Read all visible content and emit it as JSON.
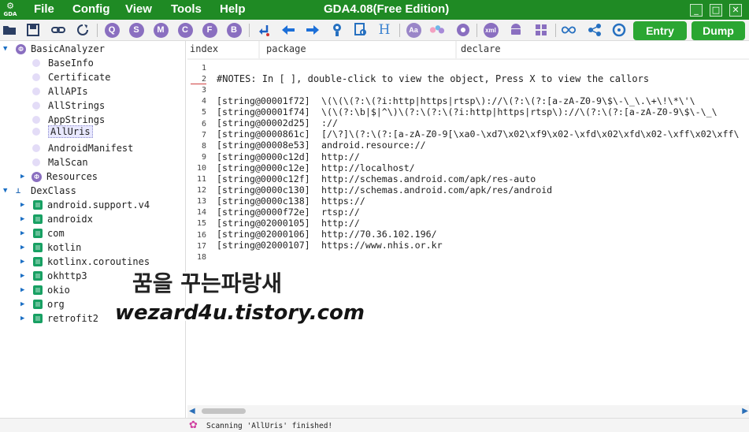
{
  "app": {
    "logo_text": "GDA",
    "title": "GDA4.08(Free Edition)",
    "menu": [
      "File",
      "Config",
      "View",
      "Tools",
      "Help"
    ]
  },
  "toolbar": {
    "circle_letters": [
      "Q",
      "S",
      "M",
      "C",
      "F",
      "B"
    ],
    "xml_label": "xml",
    "aa_label": "Aa",
    "h_label": "H",
    "entry_label": "Entry",
    "dump_label": "Dump"
  },
  "tree": {
    "root_label": "BasicAnalyzer",
    "basic_items": [
      "BaseInfo",
      "Certificate",
      "AllAPIs",
      "AllStrings",
      "AppStrings",
      "AllUris",
      "AndroidManifest",
      "MalScan"
    ],
    "selected": "AllUris",
    "resources_label": "Resources",
    "dex_label": "DexClass",
    "packages": [
      "android.support.v4",
      "androidx",
      "com",
      "kotlin",
      "kotlinx.coroutines",
      "okhttp3",
      "okio",
      "org",
      "retrofit2"
    ]
  },
  "columns": {
    "index": "index",
    "package": "package",
    "declare": "declare"
  },
  "editor": {
    "line_numbers": [
      "1",
      "2",
      "3",
      "4",
      "5",
      "6",
      "7",
      "8",
      "9",
      "10",
      "11",
      "12",
      "13",
      "14",
      "15",
      "16",
      "17",
      "18"
    ],
    "notes": "#NOTES: In [ ], double-click to view the object, Press X to view the callors",
    "rows": [
      {
        "ref": "[string@00001f72]",
        "value": "\\(\\(\\(?:\\(?i:http|https|rtsp\\)://\\(?:\\(?:[a-zA-Z0-9\\$\\-\\_\\.\\+\\!\\*\\'\\"
      },
      {
        "ref": "[string@00001f74]",
        "value": "\\(\\(?:\\b|$|^\\)\\(?:\\(?:\\(?i:http|https|rtsp\\)://\\(?:\\(?:[a-zA-Z0-9\\$\\-\\_\\"
      },
      {
        "ref": "[string@00002d25]",
        "value": "://"
      },
      {
        "ref": "[string@0000861c]",
        "value": "[/\\?]\\(?:\\(?:[a-zA-Z0-9[\\xa0-\\xd7\\x02\\xf9\\x02-\\xfd\\x02\\xfd\\x02-\\xff\\x02\\xff\\"
      },
      {
        "ref": "[string@00008e53]",
        "value": "android.resource://"
      },
      {
        "ref": "[string@0000c12d]",
        "value": "http://"
      },
      {
        "ref": "[string@0000c12e]",
        "value": "http://localhost/"
      },
      {
        "ref": "[string@0000c12f]",
        "value": "http://schemas.android.com/apk/res-auto"
      },
      {
        "ref": "[string@0000c130]",
        "value": "http://schemas.android.com/apk/res/android"
      },
      {
        "ref": "[string@0000c138]",
        "value": "https://"
      },
      {
        "ref": "[string@0000f72e]",
        "value": "rtsp://"
      },
      {
        "ref": "[string@02000105]",
        "value": "http://"
      },
      {
        "ref": "[string@02000106]",
        "value": "http://70.36.102.196/"
      },
      {
        "ref": "[string@02000107]",
        "value": "https://www.nhis.or.kr"
      }
    ]
  },
  "status": {
    "message": "Scanning 'AllUris' finished!"
  },
  "watermark": {
    "line1": "꿈을 꾸는파랑새",
    "line2": "wezard4u.tistory.com"
  },
  "colors": {
    "titlebar": "#1f8a24",
    "accent_purple": "#8a6fc0",
    "package_green": "#18a063",
    "entry_green": "#2aa632"
  }
}
